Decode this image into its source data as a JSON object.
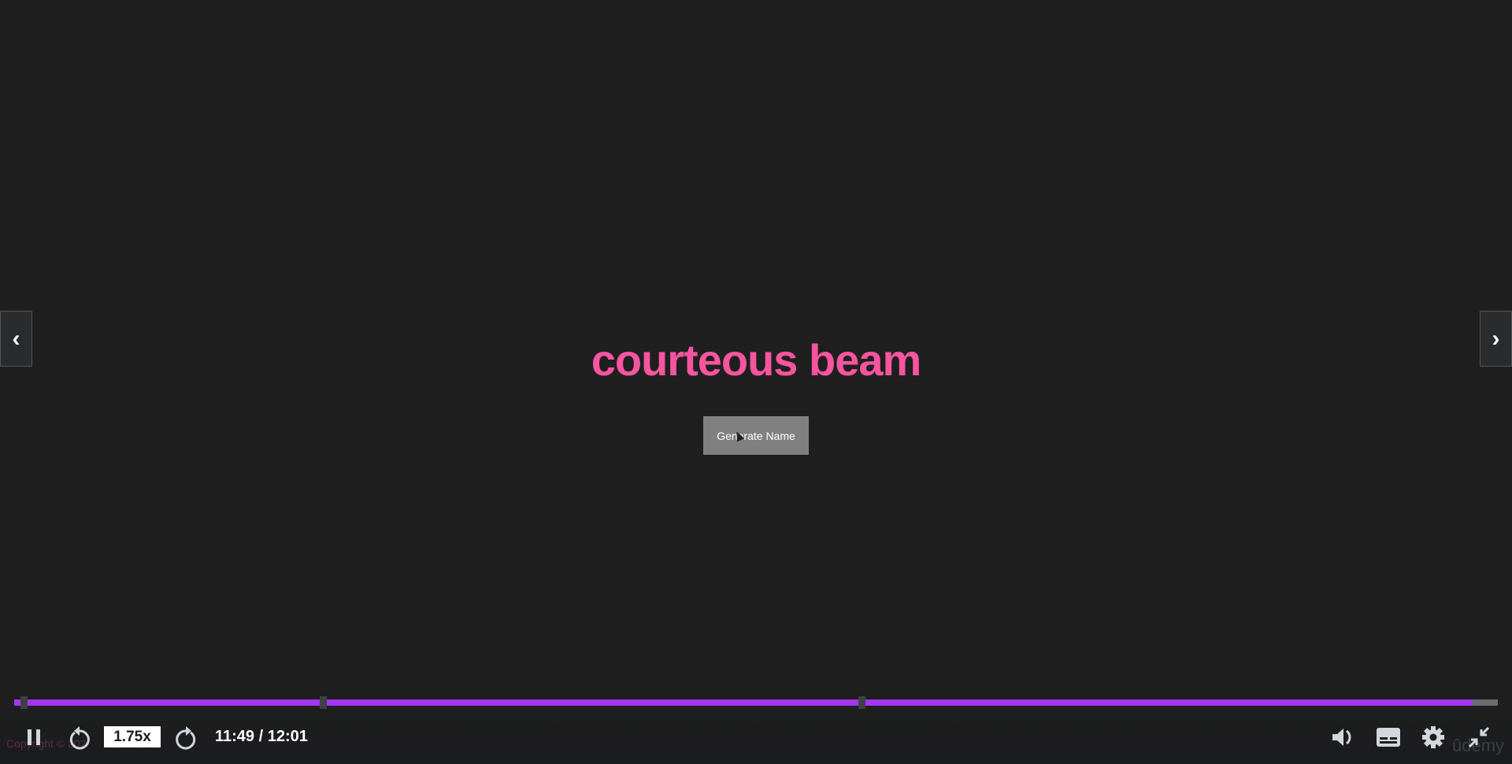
{
  "video": {
    "generated_name": "courteous beam",
    "button_label": "Generate Name",
    "copyright": "Copyright © 202",
    "watermark": "ûdemy"
  },
  "player": {
    "progress_fraction": 0.983,
    "chapter_markers": [
      0.004,
      0.206,
      0.569
    ],
    "speed": "1.75x",
    "time": "11:49 / 12:01",
    "accent_color": "#a435f0",
    "icons": [
      "pause-icon",
      "rewind-icon",
      "forward-icon",
      "volume-icon",
      "captions-icon",
      "settings-icon",
      "exit-fullscreen-icon",
      "chevron-left-icon",
      "chevron-right-icon"
    ]
  }
}
